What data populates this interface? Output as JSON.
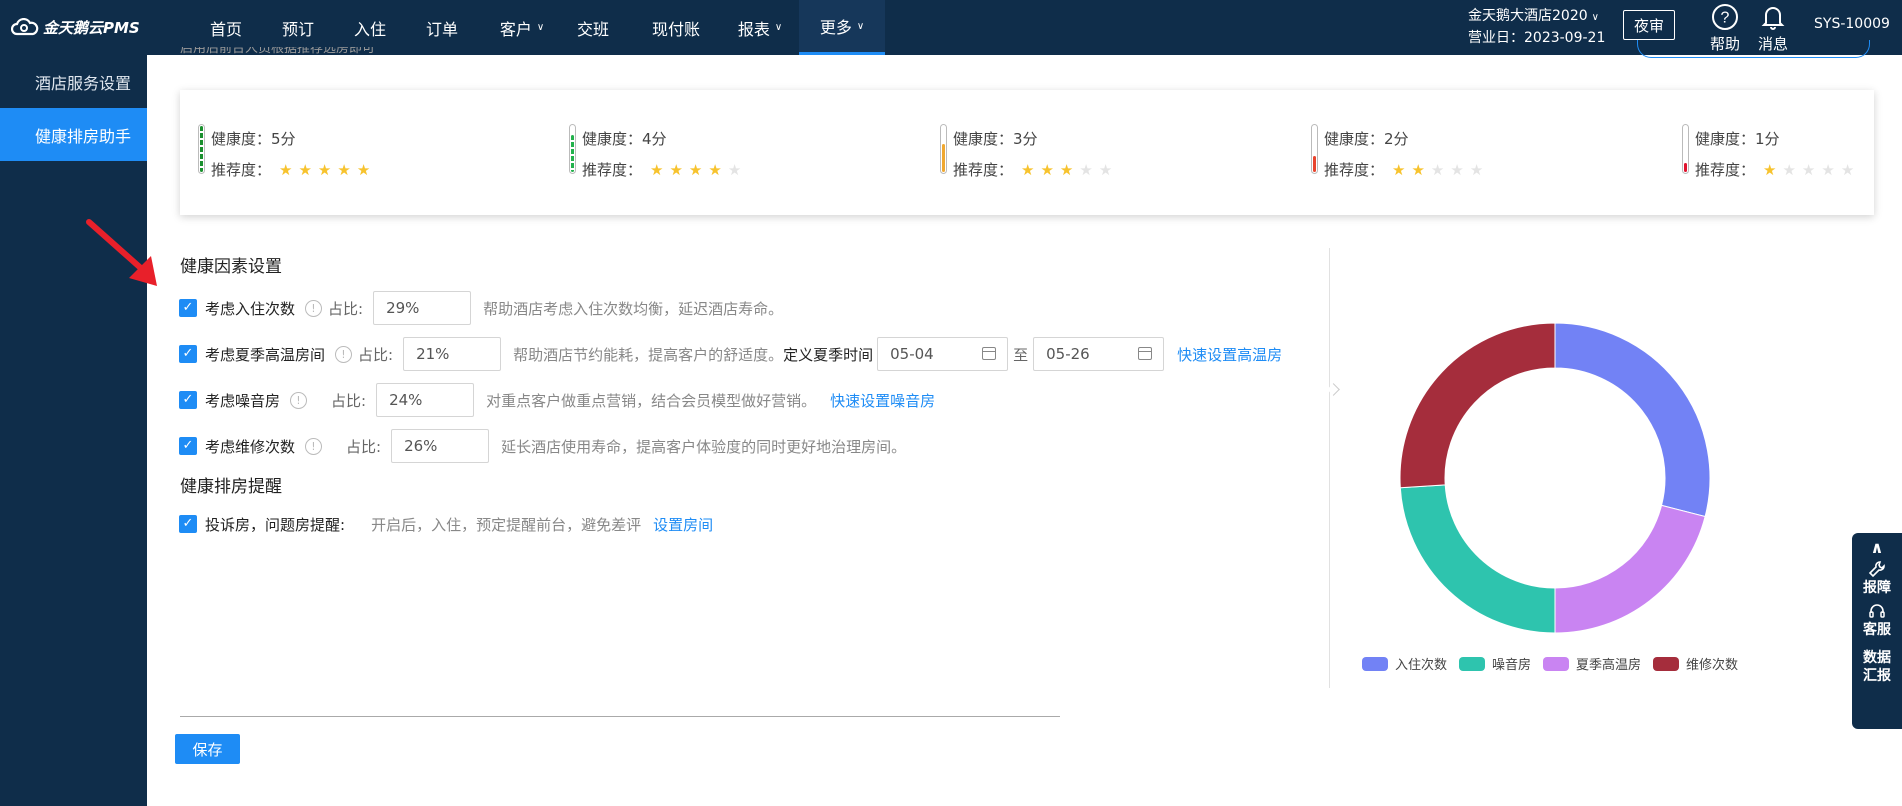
{
  "app": {
    "logo_text": "金天鹅云PMS"
  },
  "nav": {
    "items": [
      {
        "label": "首页"
      },
      {
        "label": "预订"
      },
      {
        "label": "入住"
      },
      {
        "label": "订单"
      },
      {
        "label": "客户",
        "dropdown": true
      },
      {
        "label": "交班"
      },
      {
        "label": "现付账"
      },
      {
        "label": "报表",
        "dropdown": true
      },
      {
        "label": "更多",
        "dropdown": true,
        "active": true
      }
    ]
  },
  "header": {
    "hotel_name": "金天鹅大酒店2020",
    "business_day": "营业日：2023-09-21",
    "night_audit": "夜审",
    "help": "帮助",
    "messages": "消息",
    "user": "SYS-10009"
  },
  "sidebar": {
    "items": [
      {
        "label": "酒店服务设置",
        "active": false
      },
      {
        "label": "健康排房助手",
        "active": true
      }
    ]
  },
  "top_cut_text": "启用后前台人员根据推荐选房即可",
  "health_legend": [
    {
      "health": "健康度：5分",
      "rec_label": "推荐度：",
      "stars": 5,
      "level": 1.0,
      "color": "#1a8f2e"
    },
    {
      "health": "健康度：4分",
      "rec_label": "推荐度：",
      "stars": 4,
      "level": 0.8,
      "color": "#22b14c"
    },
    {
      "health": "健康度：3分",
      "rec_label": "推荐度：",
      "stars": 3,
      "level": 0.6,
      "color": "#f0a830"
    },
    {
      "health": "健康度：2分",
      "rec_label": "推荐度：",
      "stars": 2,
      "level": 0.35,
      "color": "#e8442d"
    },
    {
      "health": "健康度：1分",
      "rec_label": "推荐度：",
      "stars": 1,
      "level": 0.2,
      "color": "#e0132e"
    }
  ],
  "factors": {
    "title": "健康因素设置",
    "ratio_label": "占比:",
    "checkins": {
      "label": "考虑入住次数",
      "value": "29%",
      "desc": "帮助酒店考虑入住次数均衡，延迟酒店寿命。"
    },
    "summer": {
      "label": "考虑夏季高温房间",
      "value": "21%",
      "desc": "帮助酒店节约能耗，提高客户的舒适度。",
      "define_label": "定义夏季时间",
      "start": "05-04",
      "to": "至",
      "end": "05-26",
      "link": "快速设置高温房"
    },
    "noise": {
      "label": "考虑噪音房",
      "value": "24%",
      "desc": "对重点客户做重点营销，结合会员模型做好营销。",
      "link": "快速设置噪音房"
    },
    "repair": {
      "label": "考虑维修次数",
      "value": "26%",
      "desc": "延长酒店使用寿命，提高客户体验度的同时更好地治理房间。"
    }
  },
  "reminder": {
    "title": "健康排房提醒",
    "label": "投诉房，问题房提醒:",
    "desc": "开启后，入住，预定提醒前台，避免差评",
    "link": "设置房间"
  },
  "save_label": "保存",
  "float_panel": {
    "report": "报障",
    "service": "客服",
    "data_line1": "数据",
    "data_line2": "汇报"
  },
  "chart_data": {
    "type": "pie",
    "donut": true,
    "categories": [
      "入住次数",
      "夏季高温房",
      "噪音房",
      "维修次数"
    ],
    "values": [
      29,
      21,
      24,
      26
    ],
    "colors": [
      "#7282f5",
      "#c984f2",
      "#2ec4ae",
      "#a52d3c"
    ],
    "legend_order": [
      "入住次数",
      "噪音房",
      "夏季高温房",
      "维修次数"
    ],
    "legend_position": "bottom"
  }
}
